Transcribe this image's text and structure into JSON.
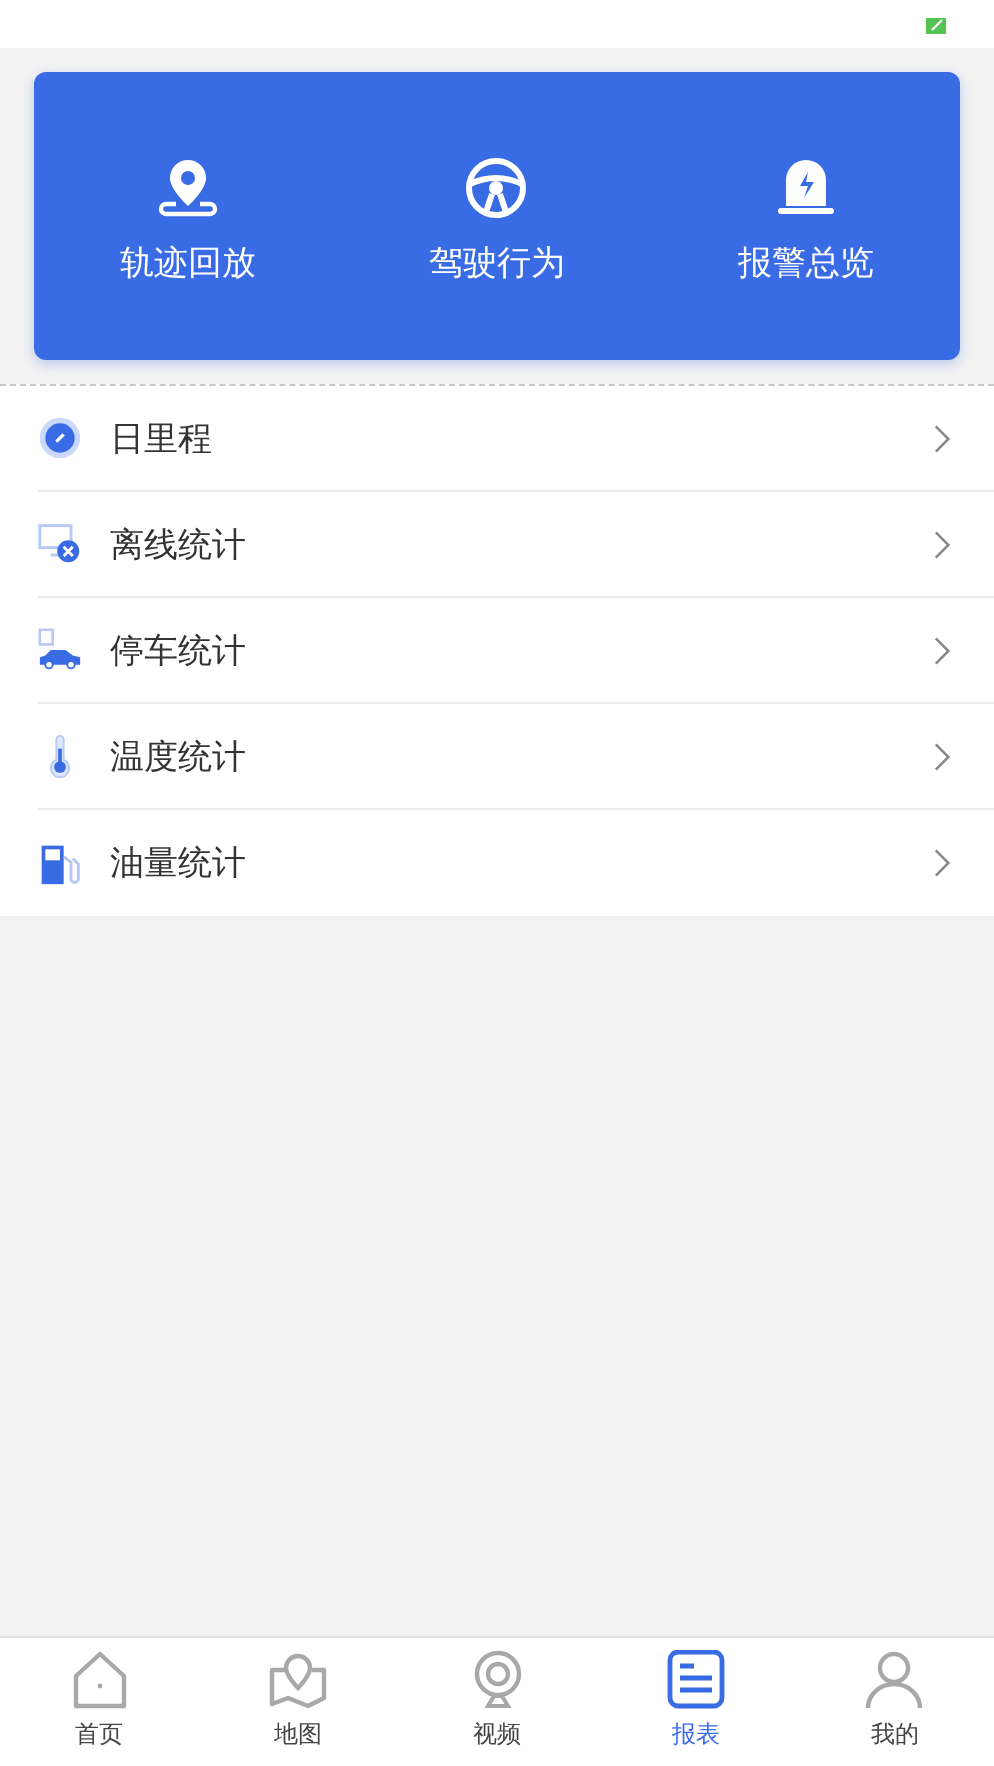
{
  "quick_actions": [
    {
      "kind": "track",
      "label": "轨迹回放"
    },
    {
      "kind": "driving",
      "label": "驾驶行为"
    },
    {
      "kind": "alarm",
      "label": "报警总览"
    }
  ],
  "report_list": [
    {
      "kind": "mileage",
      "label": "日里程"
    },
    {
      "kind": "offline",
      "label": "离线统计"
    },
    {
      "kind": "parking",
      "label": "停车统计"
    },
    {
      "kind": "temperature",
      "label": "温度统计"
    },
    {
      "kind": "fuel",
      "label": "油量统计"
    }
  ],
  "tab_bar": [
    {
      "kind": "home",
      "label": "首页",
      "selected": false
    },
    {
      "kind": "map",
      "label": "地图",
      "selected": false
    },
    {
      "kind": "video",
      "label": "视频",
      "selected": false
    },
    {
      "kind": "report",
      "label": "报表",
      "selected": true
    },
    {
      "kind": "me",
      "label": "我的",
      "selected": false
    }
  ]
}
